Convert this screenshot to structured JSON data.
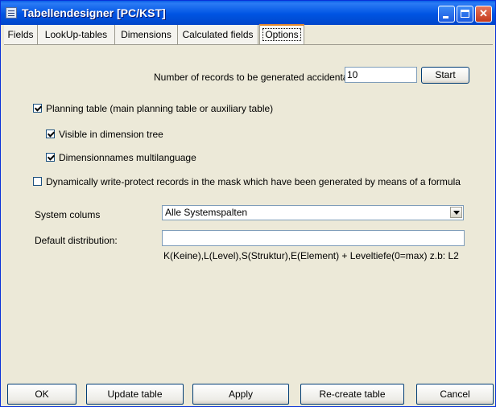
{
  "window": {
    "title": "Tabellendesigner [PC/KST]"
  },
  "tabs": [
    {
      "label": "Fields"
    },
    {
      "label": "LookUp-tables"
    },
    {
      "label": "Dimensions"
    },
    {
      "label": "Calculated fields"
    },
    {
      "label": "Options"
    }
  ],
  "options": {
    "records_label": "Number of records to be generated accidentally:",
    "records_value": "10",
    "start_label": "Start",
    "planning_table": {
      "label": "Planning table (main planning table or auxiliary table)",
      "checked": true
    },
    "visible_tree": {
      "label": "Visible in dimension tree",
      "checked": true
    },
    "dim_multilang": {
      "label": "Dimensionnames multilanguage",
      "checked": true
    },
    "write_protect": {
      "label": "Dynamically write-protect records in the mask which have been generated by means of a formula",
      "checked": false
    },
    "system_cols_label": "System colums",
    "system_cols_value": "Alle Systemspalten",
    "default_dist_label": "Default distribution:",
    "default_dist_value": "",
    "hint": "K(Keine),L(Level),S(Struktur),E(Element)  +  Leveltiefe(0=max)  z.b:  L2"
  },
  "buttons": {
    "ok": "OK",
    "update": "Update table",
    "apply": "Apply",
    "recreate": "Re-create table",
    "cancel": "Cancel"
  }
}
